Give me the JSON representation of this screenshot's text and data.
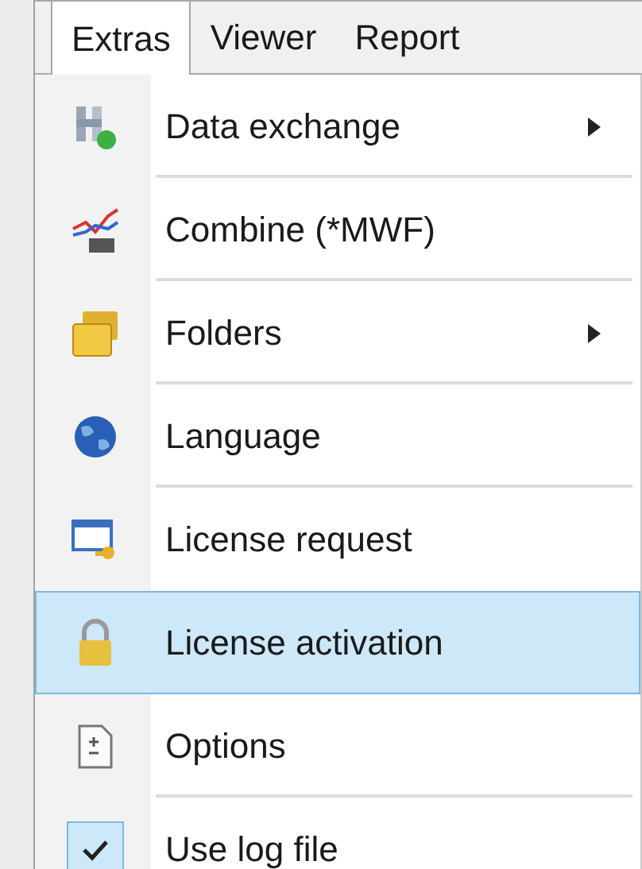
{
  "menu_bar": [
    {
      "label": "Extras",
      "selected": true
    },
    {
      "label": "Viewer",
      "selected": false
    },
    {
      "label": "Report",
      "selected": false
    }
  ],
  "menu_items": [
    {
      "label": "Data exchange",
      "kind": "exchange",
      "submenu": true,
      "selected": false,
      "checked": false
    },
    {
      "label": "Combine (*MWF)",
      "kind": "combine",
      "submenu": false,
      "selected": false,
      "checked": false
    },
    {
      "label": "Folders",
      "kind": "folders",
      "submenu": true,
      "selected": false,
      "checked": false
    },
    {
      "label": "Language",
      "kind": "globe",
      "submenu": false,
      "selected": false,
      "checked": false
    },
    {
      "label": "License request",
      "kind": "request",
      "submenu": false,
      "selected": false,
      "checked": false
    },
    {
      "label": "License activation",
      "kind": "lock",
      "submenu": false,
      "selected": true,
      "checked": false
    },
    {
      "label": "Options",
      "kind": "options",
      "submenu": false,
      "selected": false,
      "checked": false
    },
    {
      "label": "Use log file",
      "kind": "checkable",
      "submenu": false,
      "selected": false,
      "checked": true
    }
  ]
}
